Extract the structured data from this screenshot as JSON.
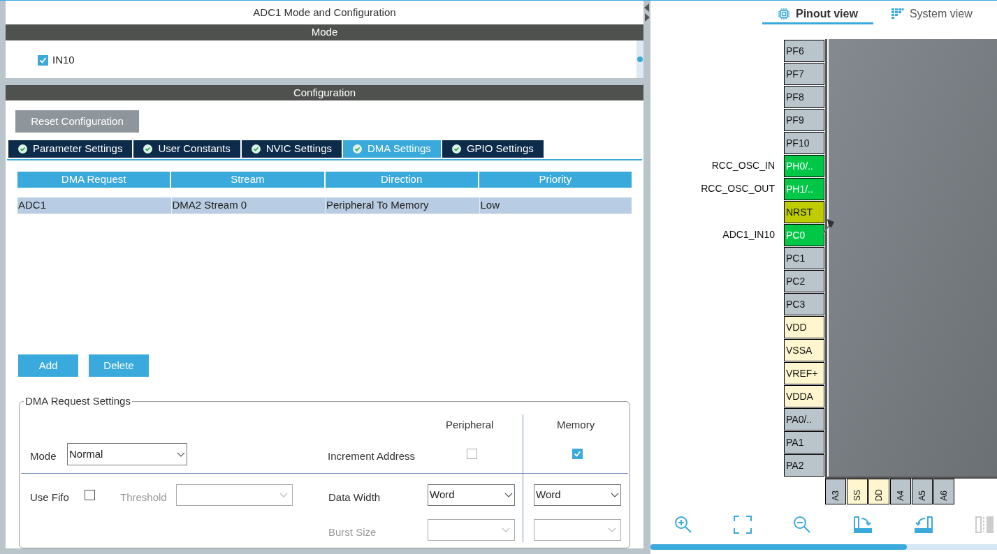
{
  "window": {
    "title": "ADC1 Mode and Configuration"
  },
  "mode": {
    "header": "Mode",
    "channels": [
      {
        "label": "IN10",
        "checked": true
      }
    ]
  },
  "configuration": {
    "header": "Configuration",
    "reset_button": "Reset Configuration",
    "tabs": [
      {
        "label": "Parameter Settings",
        "selected": false
      },
      {
        "label": "User Constants",
        "selected": false
      },
      {
        "label": "NVIC Settings",
        "selected": false
      },
      {
        "label": "DMA Settings",
        "selected": true
      },
      {
        "label": "GPIO Settings",
        "selected": false
      }
    ],
    "dma_table": {
      "columns": [
        "DMA Request",
        "Stream",
        "Direction",
        "Priority"
      ],
      "rows": [
        {
          "cells": [
            "ADC1",
            "DMA2 Stream 0",
            "Peripheral To Memory",
            "Low"
          ],
          "selected": true
        }
      ]
    },
    "buttons": [
      "Add",
      "Delete"
    ],
    "request_settings": {
      "title": "DMA Request Settings",
      "peripheral_heading": "Peripheral",
      "memory_heading": "Memory",
      "mode": {
        "label": "Mode",
        "value": "Normal"
      },
      "increment_address": {
        "label": "Increment Address",
        "peripheral": false,
        "memory": true
      },
      "use_fifo": {
        "label": "Use Fifo",
        "checked": false
      },
      "threshold": {
        "label": "Threshold",
        "disabled": true
      },
      "data_width": {
        "label": "Data Width",
        "peripheral": "Word",
        "memory": "Word",
        "disabled": false
      },
      "burst_size": {
        "label": "Burst Size",
        "disabled": true
      }
    }
  },
  "pinout": {
    "tabs": [
      {
        "label": "Pinout view",
        "selected": true
      },
      {
        "label": "System view",
        "selected": false
      }
    ],
    "left_pins": [
      {
        "name": "PF6",
        "color": "#b9c4cb"
      },
      {
        "name": "PF7",
        "color": "#b9c4cb"
      },
      {
        "name": "PF8",
        "color": "#b9c4cb"
      },
      {
        "name": "PF9",
        "color": "#b9c4cb"
      },
      {
        "name": "PF10",
        "color": "#b9c4cb"
      },
      {
        "name": "PH0/..",
        "signal": "RCC_OSC_IN",
        "color": "#00c846"
      },
      {
        "name": "PH1/..",
        "signal": "RCC_OSC_OUT",
        "color": "#00c846"
      },
      {
        "name": "NRST",
        "color": "#bfcc00"
      },
      {
        "name": "PC0",
        "signal": "ADC1_IN10",
        "color": "#00c846"
      },
      {
        "name": "PC1",
        "color": "#b9c4cb"
      },
      {
        "name": "PC2",
        "color": "#b9c4cb"
      },
      {
        "name": "PC3",
        "color": "#b9c4cb"
      },
      {
        "name": "VDD",
        "color": "#fff6d0"
      },
      {
        "name": "VSSA",
        "color": "#fff6d0"
      },
      {
        "name": "VREF+",
        "color": "#fff6d0"
      },
      {
        "name": "VDDA",
        "color": "#fff6d0"
      },
      {
        "name": "PA0/..",
        "color": "#b9c4cb"
      },
      {
        "name": "PA1",
        "color": "#b9c4cb"
      },
      {
        "name": "PA2",
        "color": "#b9c4cb"
      }
    ],
    "bottom_pins": [
      {
        "name": "A3",
        "color": "#b9c4cb"
      },
      {
        "name": "SS",
        "color": "#fff6d0"
      },
      {
        "name": "DD",
        "color": "#fff6d0"
      },
      {
        "name": "A4",
        "color": "#b9c4cb"
      },
      {
        "name": "A5",
        "color": "#b9c4cb"
      },
      {
        "name": "A6",
        "color": "#b9c4cb"
      }
    ]
  }
}
